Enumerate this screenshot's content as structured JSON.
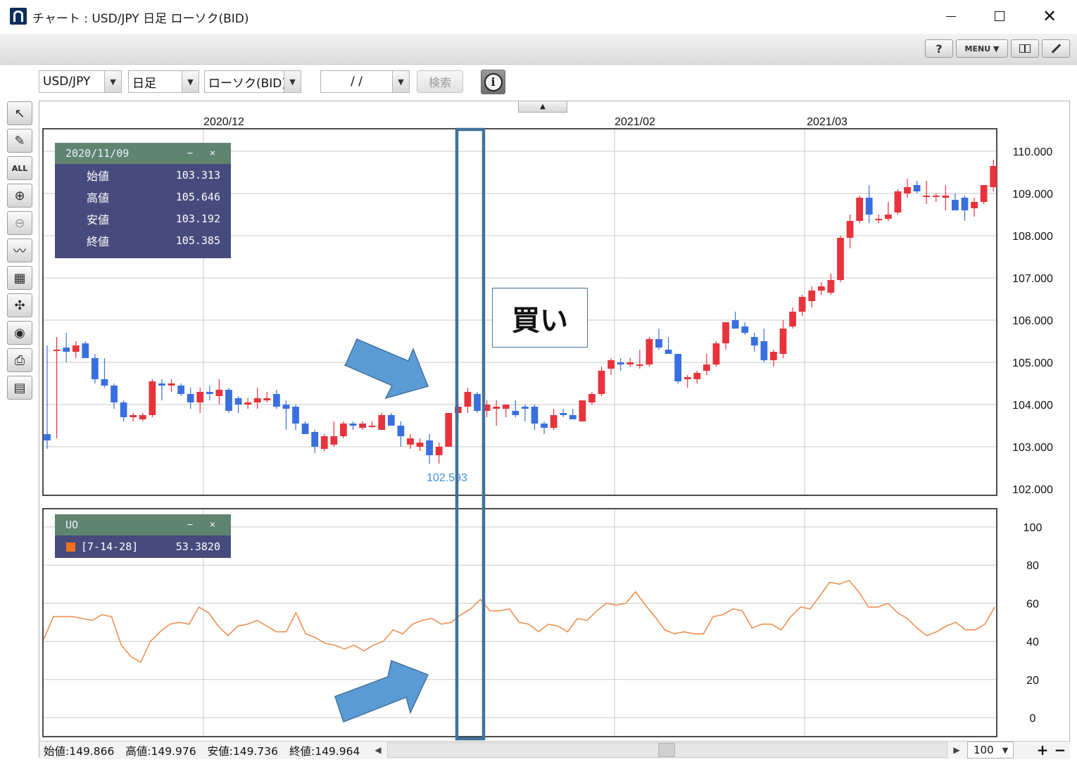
{
  "window": {
    "title": "チャート : USD/JPY 日足 ローソク(BID)",
    "close_glyph": "✕"
  },
  "toolbar": {
    "help_label": "?",
    "menu_label": "MENU ▼"
  },
  "selectors": {
    "symbol": "USD/JPY",
    "period": "日足",
    "chart_type": "ローソク(BID)",
    "date": "/ /",
    "search_label": "検索",
    "info_glyph": "i",
    "dropdown_glyph": "▼"
  },
  "tools": [
    "↖",
    "✎",
    "ALL",
    "⊕",
    "⊖",
    "〰",
    "▦",
    "✣",
    "◉",
    "⎙",
    "▤"
  ],
  "collapse_glyph": "▲",
  "x_axis_labels": [
    "2020/12",
    "2021/02",
    "2021/03"
  ],
  "price_axis_labels": [
    "110.000",
    "109.000",
    "108.000",
    "107.000",
    "106.000",
    "105.000",
    "104.000",
    "103.000",
    "102.000"
  ],
  "uo_axis_labels": [
    "100",
    "80",
    "60",
    "40",
    "20",
    "0"
  ],
  "ohlc_panel": {
    "date": "2020/11/09",
    "minimize": "−",
    "close": "×",
    "rows": [
      {
        "label": "始値",
        "value": "103.313"
      },
      {
        "label": "高値",
        "value": "105.646"
      },
      {
        "label": "安値",
        "value": "103.192"
      },
      {
        "label": "終値",
        "value": "105.385"
      }
    ]
  },
  "uo_panel": {
    "title": "UO",
    "params": "[7-14-28]",
    "value": "53.3820",
    "color": "#f07020"
  },
  "low_marker": "102.593",
  "annotation": {
    "buy_label": "買い"
  },
  "status": {
    "open": "始値:149.866",
    "high": "高値:149.976",
    "low": "安値:149.736",
    "close": "終値:149.964",
    "zoom": "100",
    "left_arrow": "◀",
    "right_arrow": "▶",
    "plus": "+",
    "minus": "−"
  },
  "colors": {
    "up": "#e8333c",
    "down": "#3a6fe0",
    "uo_line": "#f09050",
    "panel_bg": "#474a7c",
    "panel_head": "#5f8470",
    "highlight": "#41719c",
    "arrow": "#5b9bd5"
  },
  "chart_data": [
    {
      "type": "candlestick",
      "title": "USD/JPY 日足 ローソク(BID)",
      "ylim": [
        102,
        110.5
      ],
      "y_ticks": [
        110,
        109,
        108,
        107,
        106,
        105,
        104,
        103,
        102
      ],
      "x_ticks": [
        "2020/12",
        "2021/02",
        "2021/03"
      ],
      "low_label": "102.593",
      "candles": [
        [
          103.3,
          105.4,
          102.95,
          103.15
        ],
        [
          105.3,
          105.6,
          103.2,
          105.3
        ],
        [
          105.35,
          105.7,
          105.0,
          105.25
        ],
        [
          105.25,
          105.5,
          105.1,
          105.4
        ],
        [
          105.45,
          105.5,
          105.1,
          105.1
        ],
        [
          105.1,
          105.2,
          104.5,
          104.6
        ],
        [
          104.6,
          105.1,
          104.4,
          104.45
        ],
        [
          104.45,
          104.5,
          103.9,
          104.05
        ],
        [
          104.05,
          104.1,
          103.6,
          103.7
        ],
        [
          103.7,
          103.8,
          103.6,
          103.75
        ],
        [
          103.65,
          103.8,
          103.6,
          103.75
        ],
        [
          103.75,
          104.6,
          103.7,
          104.55
        ],
        [
          104.5,
          104.6,
          104.1,
          104.45
        ],
        [
          104.45,
          104.6,
          104.3,
          104.5
        ],
        [
          104.45,
          104.5,
          104.2,
          104.25
        ],
        [
          104.25,
          104.4,
          103.9,
          104.05
        ],
        [
          104.05,
          104.4,
          103.8,
          104.3
        ],
        [
          104.3,
          104.45,
          104.1,
          104.25
        ],
        [
          104.2,
          104.6,
          104.0,
          104.35
        ],
        [
          104.35,
          104.4,
          103.8,
          103.85
        ],
        [
          104.15,
          104.2,
          103.8,
          104.0
        ],
        [
          104.0,
          104.15,
          103.9,
          104.05
        ],
        [
          104.05,
          104.4,
          103.9,
          104.15
        ],
        [
          104.1,
          104.3,
          104.05,
          104.15
        ],
        [
          104.25,
          104.35,
          103.9,
          103.95
        ],
        [
          104.0,
          104.1,
          103.4,
          103.9
        ],
        [
          103.95,
          104.0,
          103.4,
          103.55
        ],
        [
          103.55,
          103.6,
          103.3,
          103.3
        ],
        [
          103.35,
          103.4,
          102.85,
          103.0
        ],
        [
          102.95,
          103.3,
          102.9,
          103.25
        ],
        [
          103.05,
          103.6,
          103.0,
          103.25
        ],
        [
          103.25,
          103.6,
          103.2,
          103.55
        ],
        [
          103.55,
          103.6,
          103.4,
          103.5
        ],
        [
          103.45,
          103.6,
          103.4,
          103.55
        ],
        [
          103.5,
          103.6,
          103.45,
          103.5
        ],
        [
          103.4,
          103.8,
          103.4,
          103.75
        ],
        [
          103.75,
          103.8,
          103.5,
          103.5
        ],
        [
          103.5,
          103.6,
          103.0,
          103.25
        ],
        [
          103.05,
          103.3,
          102.95,
          103.2
        ],
        [
          103.0,
          103.2,
          102.9,
          103.1
        ],
        [
          103.15,
          103.3,
          102.6,
          102.8
        ],
        [
          102.8,
          103.1,
          102.6,
          103.0
        ],
        [
          103.0,
          103.8,
          103.0,
          103.8
        ],
        [
          103.8,
          104.0,
          103.6,
          103.95
        ],
        [
          103.95,
          104.4,
          103.8,
          104.3
        ],
        [
          104.25,
          104.3,
          103.8,
          103.85
        ],
        [
          103.85,
          104.1,
          103.7,
          104.0
        ],
        [
          103.9,
          104.1,
          103.5,
          103.95
        ],
        [
          103.9,
          104.0,
          103.7,
          104.0
        ],
        [
          103.85,
          104.1,
          103.7,
          103.75
        ],
        [
          103.95,
          104.0,
          103.6,
          103.9
        ],
        [
          103.95,
          104.0,
          103.4,
          103.55
        ],
        [
          103.55,
          103.6,
          103.3,
          103.45
        ],
        [
          103.45,
          103.9,
          103.4,
          103.75
        ],
        [
          103.8,
          103.9,
          103.7,
          103.75
        ],
        [
          103.75,
          103.9,
          103.65,
          103.65
        ],
        [
          103.6,
          104.1,
          103.6,
          104.1
        ],
        [
          104.05,
          104.3,
          104.0,
          104.25
        ],
        [
          104.25,
          104.9,
          104.2,
          104.8
        ],
        [
          104.85,
          105.1,
          104.7,
          105.05
        ],
        [
          105.0,
          105.1,
          104.8,
          104.95
        ],
        [
          104.95,
          105.1,
          104.9,
          105.0
        ],
        [
          104.95,
          105.3,
          104.85,
          104.95
        ],
        [
          104.95,
          105.6,
          104.9,
          105.55
        ],
        [
          105.55,
          105.8,
          105.3,
          105.35
        ],
        [
          105.3,
          105.6,
          105.2,
          105.2
        ],
        [
          105.2,
          105.2,
          104.5,
          104.55
        ],
        [
          104.6,
          104.7,
          104.4,
          104.65
        ],
        [
          104.6,
          104.8,
          104.5,
          104.75
        ],
        [
          104.8,
          105.2,
          104.7,
          104.95
        ],
        [
          104.95,
          105.5,
          104.9,
          105.45
        ],
        [
          105.45,
          105.95,
          105.3,
          105.95
        ],
        [
          106.0,
          106.2,
          105.8,
          105.8
        ],
        [
          105.85,
          105.95,
          105.65,
          105.7
        ],
        [
          105.6,
          105.7,
          105.25,
          105.4
        ],
        [
          105.5,
          105.8,
          105.0,
          105.05
        ],
        [
          105.05,
          105.3,
          104.9,
          105.25
        ],
        [
          105.2,
          106.0,
          105.1,
          105.8
        ],
        [
          105.85,
          106.3,
          105.8,
          106.2
        ],
        [
          106.2,
          106.6,
          106.1,
          106.55
        ],
        [
          106.45,
          106.8,
          106.3,
          106.7
        ],
        [
          106.7,
          106.9,
          106.6,
          106.8
        ],
        [
          106.65,
          107.1,
          106.6,
          106.95
        ],
        [
          106.95,
          108.0,
          106.9,
          107.95
        ],
        [
          107.95,
          108.5,
          107.7,
          108.35
        ],
        [
          108.35,
          108.95,
          108.3,
          108.9
        ],
        [
          108.9,
          109.2,
          108.3,
          108.5
        ],
        [
          108.4,
          108.5,
          108.3,
          108.4
        ],
        [
          108.4,
          108.8,
          108.35,
          108.5
        ],
        [
          108.55,
          109.1,
          108.5,
          109.05
        ],
        [
          109.0,
          109.35,
          108.9,
          109.15
        ],
        [
          109.2,
          109.3,
          109.0,
          109.05
        ],
        [
          108.95,
          109.3,
          108.75,
          108.95
        ],
        [
          108.95,
          109.0,
          108.8,
          108.95
        ],
        [
          108.9,
          109.2,
          108.6,
          108.95
        ],
        [
          108.85,
          109.0,
          108.6,
          108.6
        ],
        [
          108.9,
          108.95,
          108.35,
          108.6
        ],
        [
          108.65,
          108.9,
          108.45,
          108.8
        ],
        [
          108.8,
          109.2,
          108.75,
          109.2
        ],
        [
          109.15,
          109.8,
          109.05,
          109.65
        ]
      ]
    },
    {
      "type": "line",
      "title": "UO [7-14-28]",
      "ylim": [
        0,
        100
      ],
      "y_ticks": [
        100,
        80,
        60,
        40,
        20,
        0
      ],
      "series": [
        {
          "name": "[7-14-28]",
          "values": [
            41,
            53,
            53,
            53,
            52,
            51,
            54,
            53,
            38,
            32,
            29,
            40,
            45,
            49,
            50,
            49,
            58,
            55,
            48,
            43,
            48,
            49,
            51,
            48,
            45,
            45,
            55,
            44,
            42,
            39,
            38,
            36,
            38,
            35,
            38,
            40,
            46,
            44,
            49,
            51,
            52,
            49,
            50,
            54,
            57,
            62,
            56,
            56,
            57,
            50,
            49,
            45,
            49,
            48,
            45,
            52,
            51,
            56,
            60,
            59,
            60,
            66,
            59,
            53,
            46,
            44,
            45,
            44,
            44,
            53,
            54,
            57,
            56,
            47,
            49,
            49,
            46,
            53,
            58,
            57,
            64,
            71,
            70,
            72,
            66,
            58,
            58,
            60,
            55,
            52,
            47,
            43,
            45,
            48,
            50,
            46,
            46,
            49,
            58
          ]
        }
      ]
    }
  ]
}
